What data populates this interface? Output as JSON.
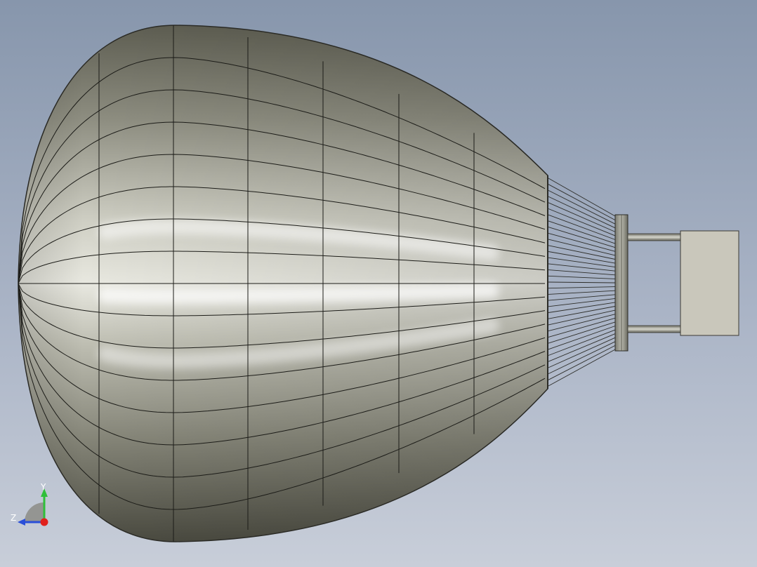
{
  "viewport": {
    "background_top": "#8796ac",
    "background_bottom": "#c8ced9"
  },
  "model": {
    "parts": [
      "balloon-envelope",
      "suspension-lines",
      "load-ring",
      "support-rods",
      "payload-box"
    ],
    "envelope_color": "#9a9a8a",
    "highlight_color": "#ffffff",
    "payload_color": "#c9c7bb"
  },
  "triad": {
    "y_label": "Y",
    "z_label": "Z",
    "y_color": "#2fbf3a",
    "z_color": "#2a4fd8",
    "x_color": "#e0201c"
  }
}
